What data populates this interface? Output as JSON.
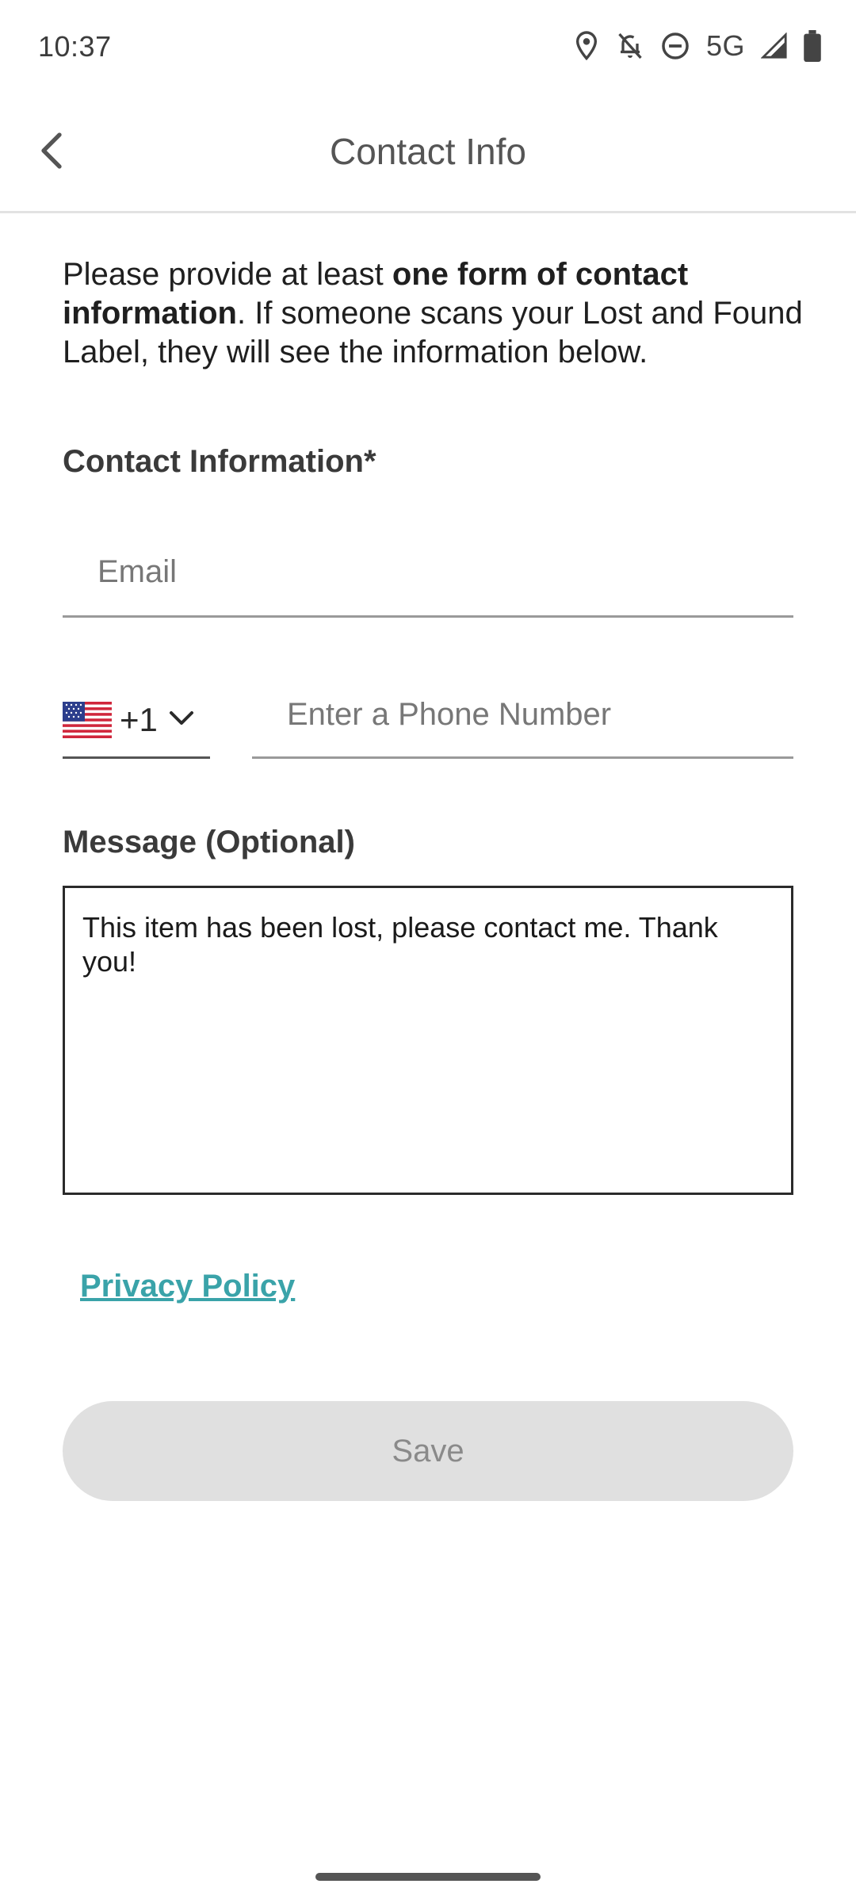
{
  "status_bar": {
    "time": "10:37",
    "network": "5G",
    "icons": [
      "location-icon",
      "notifications-off-icon",
      "do-not-disturb-icon",
      "signal-icon",
      "battery-icon"
    ]
  },
  "header": {
    "title": "Contact Info",
    "back_icon": "chevron-left-icon"
  },
  "intro": {
    "part1": "Please provide at least ",
    "bold": "one form of contact information",
    "part2": ". If someone scans your Lost and Found Label, they will see the information below."
  },
  "contact": {
    "label": "Contact Information*",
    "email": {
      "placeholder": "Email",
      "value": ""
    },
    "phone": {
      "country_flag": "us-flag-icon",
      "country_code": "+1",
      "placeholder": "Enter a Phone Number",
      "value": ""
    }
  },
  "message": {
    "label": "Message (Optional)",
    "value": "This item has been lost, please contact me. Thank you!"
  },
  "privacy_link": "Privacy Policy",
  "save_label": "Save",
  "colors": {
    "link": "#3aa3a9",
    "button_disabled_bg": "#e0e0e0",
    "button_disabled_text": "#8a8a8a"
  }
}
